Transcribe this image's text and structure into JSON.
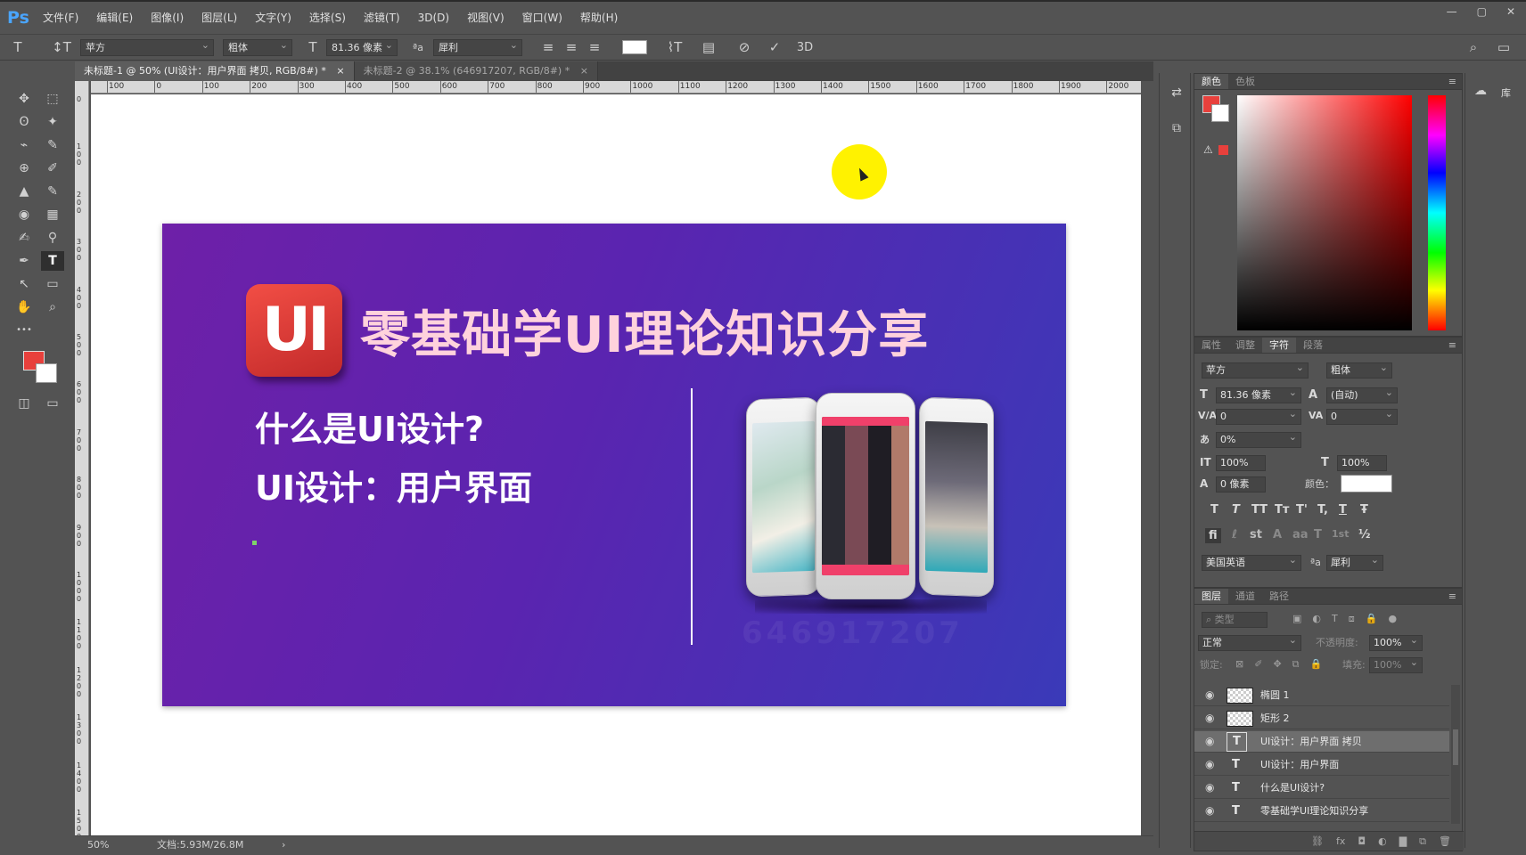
{
  "app": {
    "logo": "Ps",
    "menu": [
      "文件(F)",
      "编辑(E)",
      "图像(I)",
      "图层(L)",
      "文字(Y)",
      "选择(S)",
      "滤镜(T)",
      "3D(D)",
      "视图(V)",
      "窗口(W)",
      "帮助(H)"
    ],
    "window_controls": [
      "—",
      "▢",
      "✕"
    ]
  },
  "options_bar": {
    "tool_icon": "T",
    "orient_icon": "↕T",
    "font_family": "苹方",
    "font_style": "粗体",
    "size_icon": "T",
    "font_size": "81.36 像素",
    "aa_icon": "ªa",
    "anti_alias": "犀利",
    "align_left": "≡",
    "align_center": "≡",
    "align_right": "≡",
    "warp_icon": "⌇T",
    "panel_icon": "▤",
    "cancel_icon": "⊘",
    "commit_icon": "✓",
    "label_3d": "3D",
    "search_icon": "⌕",
    "workspace_icon": "▭"
  },
  "tabs": [
    {
      "label": "未标题-1 @ 50% (UI设计：用户界面 拷贝, RGB/8#) *",
      "close": "×",
      "active": true
    },
    {
      "label": "未标题-2 @ 38.1% (646917207, RGB/8#) *",
      "close": "×",
      "active": false
    }
  ],
  "ruler": {
    "top": [
      "100",
      "0",
      "100",
      "200",
      "300",
      "400",
      "500",
      "600",
      "700",
      "800",
      "900",
      "1000",
      "1100",
      "1200",
      "1300",
      "1400",
      "1500",
      "1600",
      "1700",
      "1800",
      "1900",
      "2000"
    ],
    "left": [
      "0",
      "1 0 0",
      "2 0 0",
      "3 0 0",
      "4 0 0",
      "5 0 0",
      "6 0 0",
      "7 0 0",
      "8 0 0",
      "9 0 0",
      "1 0 0 0",
      "1 1 0 0",
      "1 2 0 0",
      "1 3 0 0",
      "1 4 0 0",
      "1 5 0 0"
    ]
  },
  "tools": [
    "✥",
    "⬚",
    "ʘ",
    "✦",
    "⌁",
    "✎",
    "⊕",
    "✐",
    "▲",
    "✎",
    "◉",
    "▦",
    "✍",
    "⚲",
    "✒",
    "T",
    "↖",
    "▭",
    "✋",
    "⌕",
    "•••",
    "◫",
    "▭"
  ],
  "banner": {
    "logo_text": "UI",
    "title": "零基础学UI理论知识分享",
    "subtitle1": "什么是UI设计?",
    "subtitle2": "UI设计：用户界面",
    "watermark": "646917207"
  },
  "status": {
    "zoom": "50%",
    "doc": "文档:5.93M/26.8M",
    "arrow": "›"
  },
  "mini_icons": [
    "⇄",
    "⧉"
  ],
  "library": {
    "icon": "☁",
    "label": "库"
  },
  "color_panel": {
    "tabs": [
      "颜色",
      "色板"
    ],
    "menu": "≡",
    "warn_icon": "⚠",
    "fg": "#e8403c",
    "bg": "#ffffff"
  },
  "char_panel": {
    "tabs": [
      "属性",
      "调整",
      "字符",
      "段落"
    ],
    "active": "字符",
    "menu": "≡",
    "font_family": "苹方",
    "font_style": "粗体",
    "size_icon": "T",
    "size": "81.36 像素",
    "leading_icon": "A",
    "leading": "(自动)",
    "kern_icon": "V/A",
    "kerning": "0",
    "tracking_icon": "VA",
    "tracking": "0",
    "scale_icon": "あ",
    "tsume": "0%",
    "vscale_icon": "IT",
    "vscale": "100%",
    "hscale_icon": "T",
    "hscale": "100%",
    "baseline_icon": "A",
    "baseline": "0 像素",
    "color_label": "颜色：",
    "style_buttons": [
      "T",
      "T",
      "TT",
      "Tт",
      "T'",
      "T,",
      "T",
      "Ŧ"
    ],
    "opentype_buttons": [
      "fi",
      "ℓ",
      "st",
      "A",
      "aa",
      "T",
      "1st",
      "½"
    ],
    "language": "美国英语",
    "aa_icon": "ªa",
    "anti_alias": "犀利"
  },
  "layers_panel": {
    "tabs": [
      "图层",
      "通道",
      "路径"
    ],
    "menu": "≡",
    "filter": "⌕ 类型",
    "filter_icons": [
      "▣",
      "◐",
      "T",
      "⧈",
      "🔒",
      "●"
    ],
    "blend_mode": "正常",
    "opacity_label": "不透明度:",
    "opacity": "100%",
    "lock_label": "锁定:",
    "lock_icons": [
      "⊠",
      "✐",
      "✥",
      "⧉",
      "🔒"
    ],
    "fill_label": "填充:",
    "fill": "100%",
    "eye_icon": "◉",
    "text_icon": "T",
    "layers": [
      {
        "name": "椭圆 1",
        "type": "shape"
      },
      {
        "name": "矩形 2",
        "type": "shape"
      },
      {
        "name": "UI设计：用户界面 拷贝",
        "type": "text",
        "selected": true
      },
      {
        "name": "UI设计：用户界面",
        "type": "text"
      },
      {
        "name": "什么是UI设计?",
        "type": "text"
      },
      {
        "name": "零基础学UI理论知识分享",
        "type": "text"
      }
    ],
    "footer_icons": [
      "⛓",
      "fx",
      "◘",
      "◐",
      "▇",
      "⧉",
      "🗑"
    ]
  }
}
